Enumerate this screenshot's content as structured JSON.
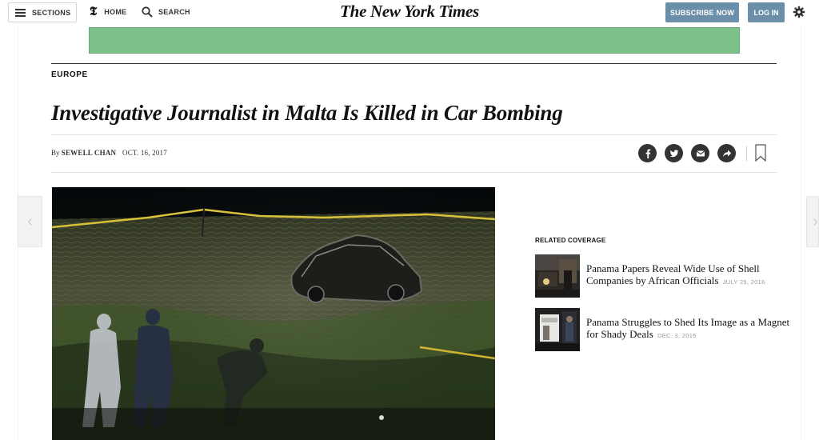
{
  "header": {
    "sections_label": "SECTIONS",
    "home_label": "HOME",
    "search_label": "SEARCH",
    "masthead": "The New York Times",
    "subscribe_label": "SUBSCRIBE NOW",
    "login_label": "LOG IN"
  },
  "colors": {
    "header_button": "#6b8fa8",
    "ad_banner": "#7dc28a"
  },
  "article": {
    "section": "EUROPE",
    "headline": "Investigative Journalist in Malta Is Killed in Car Bombing",
    "byline_prefix": "By ",
    "author": "SEWELL CHAN",
    "date": "OCT. 16, 2017"
  },
  "share_icons": [
    "facebook-icon",
    "twitter-icon",
    "email-icon",
    "share-arrow-icon",
    "bookmark-icon"
  ],
  "related": {
    "title": "RELATED COVERAGE",
    "items": [
      {
        "headline": "Panama Papers Reveal Wide Use of Shell Companies by African Officials",
        "date": "JULY 25, 2016"
      },
      {
        "headline": "Panama Struggles to Shed Its Image as a Magnet for Shady Deals",
        "date": "DEC. 3, 2016"
      }
    ]
  },
  "nav_arrows": {
    "prev": "‹",
    "next": "›"
  }
}
